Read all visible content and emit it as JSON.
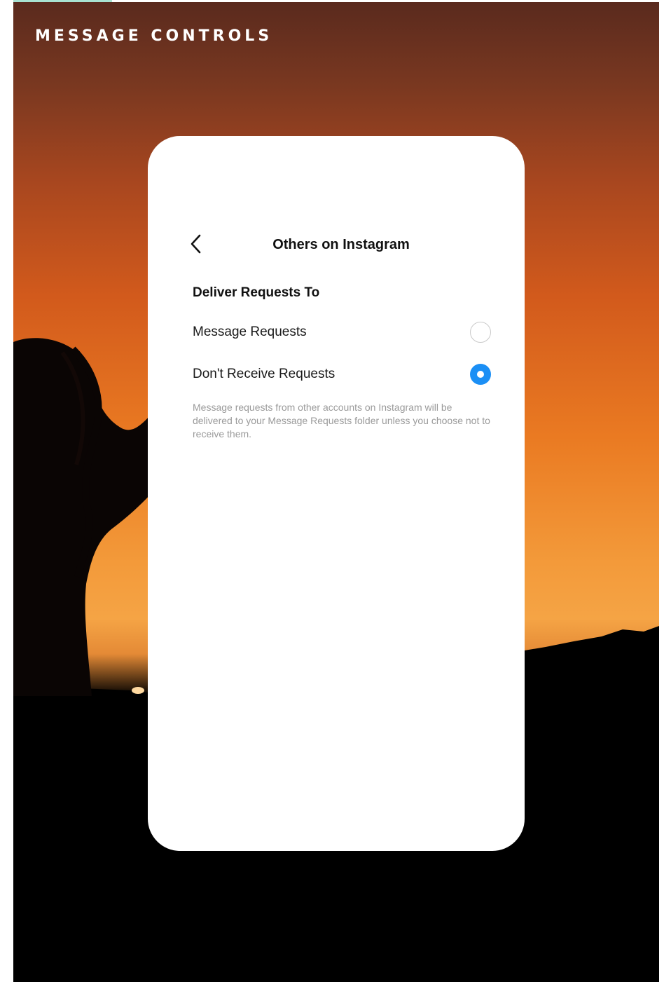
{
  "banner": {
    "headline": "MESSAGE CONTROLS"
  },
  "screen": {
    "title": "Others on Instagram",
    "back_icon": "chevron-left-icon",
    "section_heading": "Deliver Requests To",
    "options": [
      {
        "label": "Message Requests",
        "selected": false
      },
      {
        "label": "Don't Receive Requests",
        "selected": true
      }
    ],
    "help_text": "Message requests from other accounts on Instagram will be delivered to your Message Requests folder unless you choose not to receive them."
  },
  "colors": {
    "radio_selected": "#1b8ff5",
    "accent_bar": "#a8e2d2",
    "sky_top": "#5a2a1e",
    "sky_glow": "#f5a445"
  }
}
